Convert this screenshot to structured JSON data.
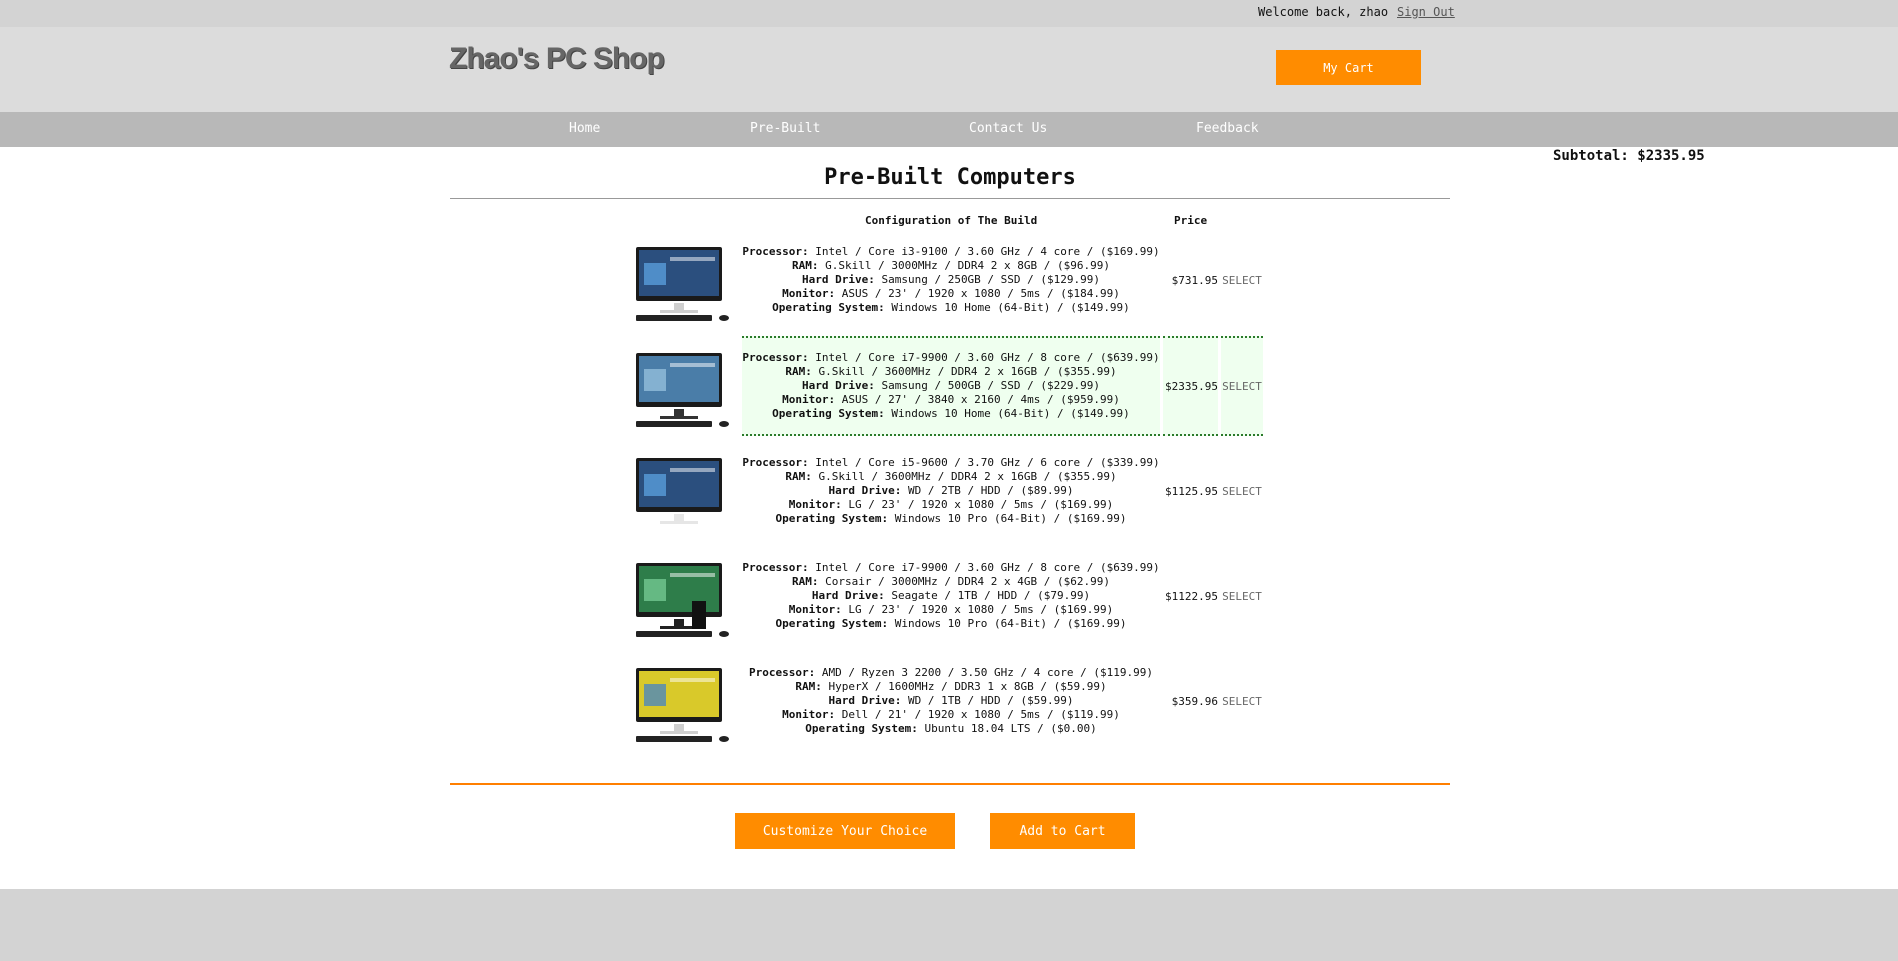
{
  "topbar": {
    "welcome": "Welcome back, zhao",
    "signout": "Sign Out"
  },
  "header": {
    "logo": "Zhao's PC Shop",
    "cart": "My Cart"
  },
  "nav": [
    {
      "label": "Home"
    },
    {
      "label": "Pre-Built"
    },
    {
      "label": "Contact Us"
    },
    {
      "label": "Feedback"
    }
  ],
  "subtotal": "Subtotal: $2335.95",
  "page_title": "Pre-Built Computers",
  "columns": {
    "config": "Configuration of The Build",
    "price": "Price"
  },
  "field_labels": {
    "processor": "Processor:",
    "ram": "RAM:",
    "hdd": "Hard Drive:",
    "monitor": "Monitor:",
    "os": "Operating System:"
  },
  "select_label": "SELECT",
  "builds": [
    {
      "image": "all-in-one-pc-windows-icon",
      "processor": "Intel / Core i3-9100 / 3.60 GHz / 4 core / ($169.99)",
      "ram": "G.Skill / 3000MHz / DDR4 2 x 8GB / ($96.99)",
      "hdd": "Samsung / 250GB / SSD / ($129.99)",
      "monitor": "ASUS / 23' / 1920 x 1080 / 5ms / ($184.99)",
      "os": "Windows 10 Home (64-Bit) / ($149.99)",
      "price": "$731.95",
      "selected": false
    },
    {
      "image": "all-in-one-pc-landscape-icon",
      "processor": "Intel / Core i7-9900 / 3.60 GHz / 8 core / ($639.99)",
      "ram": "G.Skill / 3600MHz / DDR4 2 x 16GB / ($355.99)",
      "hdd": "Samsung / 500GB / SSD / ($229.99)",
      "monitor": "ASUS / 27' / 3840 x 2160 / 4ms / ($959.99)",
      "os": "Windows 10 Home (64-Bit) / ($149.99)",
      "price": "$2335.95",
      "selected": true
    },
    {
      "image": "all-in-one-pc-white-icon",
      "processor": "Intel / Core i5-9600 / 3.70 GHz / 6 core / ($339.99)",
      "ram": "G.Skill / 3600MHz / DDR4 2 x 16GB / ($355.99)",
      "hdd": "WD / 2TB / HDD / ($89.99)",
      "monitor": "LG / 23' / 1920 x 1080 / 5ms / ($169.99)",
      "os": "Windows 10 Pro (64-Bit) / ($169.99)",
      "price": "$1125.95",
      "selected": false
    },
    {
      "image": "desktop-tower-pc-icon",
      "processor": "Intel / Core i7-9900 / 3.60 GHz / 8 core / ($639.99)",
      "ram": "Corsair / 3000MHz / DDR4 2 x 4GB / ($62.99)",
      "hdd": "Seagate / 1TB / HDD / ($79.99)",
      "monitor": "LG / 23' / 1920 x 1080 / 5ms / ($169.99)",
      "os": "Windows 10 Pro (64-Bit) / ($169.99)",
      "price": "$1122.95",
      "selected": false
    },
    {
      "image": "all-in-one-pc-yellow-icon",
      "processor": "AMD / Ryzen 3 2200 / 3.50 GHz / 4 core / ($119.99)",
      "ram": "HyperX / 1600MHz / DDR3 1 x 8GB / ($59.99)",
      "hdd": "WD / 1TB / HDD / ($59.99)",
      "monitor": "Dell / 21' / 1920 x 1080 / 5ms / ($119.99)",
      "os": "Ubuntu 18.04 LTS / ($0.00)",
      "price": "$359.96",
      "selected": false
    }
  ],
  "buttons": {
    "customize": "Customize Your Choice",
    "add_to_cart": "Add to Cart"
  },
  "colors": {
    "accent": "#ff8c00",
    "selected_bg": "#efffef",
    "selected_border": "#2a7a2a"
  }
}
